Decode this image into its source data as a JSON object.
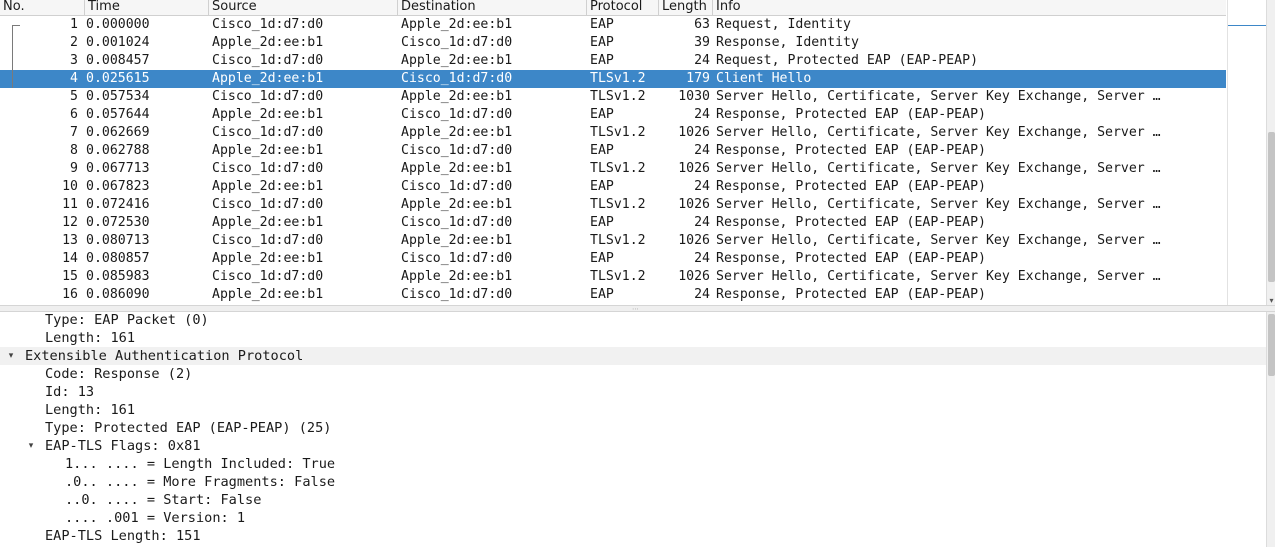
{
  "packet_list": {
    "columns": [
      "No.",
      "Time",
      "Source",
      "Destination",
      "Protocol",
      "Length",
      "Info"
    ],
    "selected_no": "4",
    "rows": [
      {
        "no": "1",
        "time": "0.000000",
        "src": "Cisco_1d:d7:d0",
        "dst": "Apple_2d:ee:b1",
        "proto": "EAP",
        "len": "63",
        "info": "Request, Identity"
      },
      {
        "no": "2",
        "time": "0.001024",
        "src": "Apple_2d:ee:b1",
        "dst": "Cisco_1d:d7:d0",
        "proto": "EAP",
        "len": "39",
        "info": "Response, Identity"
      },
      {
        "no": "3",
        "time": "0.008457",
        "src": "Cisco_1d:d7:d0",
        "dst": "Apple_2d:ee:b1",
        "proto": "EAP",
        "len": "24",
        "info": "Request, Protected EAP (EAP-PEAP)"
      },
      {
        "no": "4",
        "time": "0.025615",
        "src": "Apple_2d:ee:b1",
        "dst": "Cisco_1d:d7:d0",
        "proto": "TLSv1.2",
        "len": "179",
        "info": "Client Hello"
      },
      {
        "no": "5",
        "time": "0.057534",
        "src": "Cisco_1d:d7:d0",
        "dst": "Apple_2d:ee:b1",
        "proto": "TLSv1.2",
        "len": "1030",
        "info": "Server Hello, Certificate, Server Key Exchange, Server …"
      },
      {
        "no": "6",
        "time": "0.057644",
        "src": "Apple_2d:ee:b1",
        "dst": "Cisco_1d:d7:d0",
        "proto": "EAP",
        "len": "24",
        "info": "Response, Protected EAP (EAP-PEAP)"
      },
      {
        "no": "7",
        "time": "0.062669",
        "src": "Cisco_1d:d7:d0",
        "dst": "Apple_2d:ee:b1",
        "proto": "TLSv1.2",
        "len": "1026",
        "info": "Server Hello, Certificate, Server Key Exchange, Server …"
      },
      {
        "no": "8",
        "time": "0.062788",
        "src": "Apple_2d:ee:b1",
        "dst": "Cisco_1d:d7:d0",
        "proto": "EAP",
        "len": "24",
        "info": "Response, Protected EAP (EAP-PEAP)"
      },
      {
        "no": "9",
        "time": "0.067713",
        "src": "Cisco_1d:d7:d0",
        "dst": "Apple_2d:ee:b1",
        "proto": "TLSv1.2",
        "len": "1026",
        "info": "Server Hello, Certificate, Server Key Exchange, Server …"
      },
      {
        "no": "10",
        "time": "0.067823",
        "src": "Apple_2d:ee:b1",
        "dst": "Cisco_1d:d7:d0",
        "proto": "EAP",
        "len": "24",
        "info": "Response, Protected EAP (EAP-PEAP)"
      },
      {
        "no": "11",
        "time": "0.072416",
        "src": "Cisco_1d:d7:d0",
        "dst": "Apple_2d:ee:b1",
        "proto": "TLSv1.2",
        "len": "1026",
        "info": "Server Hello, Certificate, Server Key Exchange, Server …"
      },
      {
        "no": "12",
        "time": "0.072530",
        "src": "Apple_2d:ee:b1",
        "dst": "Cisco_1d:d7:d0",
        "proto": "EAP",
        "len": "24",
        "info": "Response, Protected EAP (EAP-PEAP)"
      },
      {
        "no": "13",
        "time": "0.080713",
        "src": "Cisco_1d:d7:d0",
        "dst": "Apple_2d:ee:b1",
        "proto": "TLSv1.2",
        "len": "1026",
        "info": "Server Hello, Certificate, Server Key Exchange, Server …"
      },
      {
        "no": "14",
        "time": "0.080857",
        "src": "Apple_2d:ee:b1",
        "dst": "Cisco_1d:d7:d0",
        "proto": "EAP",
        "len": "24",
        "info": "Response, Protected EAP (EAP-PEAP)"
      },
      {
        "no": "15",
        "time": "0.085983",
        "src": "Cisco_1d:d7:d0",
        "dst": "Apple_2d:ee:b1",
        "proto": "TLSv1.2",
        "len": "1026",
        "info": "Server Hello, Certificate, Server Key Exchange, Server …"
      },
      {
        "no": "16",
        "time": "0.086090",
        "src": "Apple_2d:ee:b1",
        "dst": "Cisco_1d:d7:d0",
        "proto": "EAP",
        "len": "24",
        "info": "Response, Protected EAP (EAP-PEAP)"
      }
    ]
  },
  "details": {
    "lines": [
      {
        "text": "Type: EAP Packet (0)",
        "depth": 1,
        "arrow": ""
      },
      {
        "text": "Length: 161",
        "depth": 1,
        "arrow": ""
      },
      {
        "text": "Extensible Authentication Protocol",
        "depth": 0,
        "arrow": "expanded",
        "highlight": true
      },
      {
        "text": "Code: Response (2)",
        "depth": 1,
        "arrow": ""
      },
      {
        "text": "Id: 13",
        "depth": 1,
        "arrow": ""
      },
      {
        "text": "Length: 161",
        "depth": 1,
        "arrow": ""
      },
      {
        "text": "Type: Protected EAP (EAP-PEAP) (25)",
        "depth": 1,
        "arrow": ""
      },
      {
        "text": "EAP-TLS Flags: 0x81",
        "depth": 1,
        "arrow": "expanded"
      },
      {
        "text": "1... .... = Length Included: True",
        "depth": 2,
        "arrow": ""
      },
      {
        "text": ".0.. .... = More Fragments: False",
        "depth": 2,
        "arrow": ""
      },
      {
        "text": "..0. .... = Start: False",
        "depth": 2,
        "arrow": ""
      },
      {
        "text": ".... .001 = Version: 1",
        "depth": 2,
        "arrow": ""
      },
      {
        "text": "EAP-TLS Length: 151",
        "depth": 1,
        "arrow": ""
      }
    ]
  },
  "icons": {
    "expanded": "▾",
    "scroll_down": "▾"
  },
  "colors": {
    "selection": "#3d87c8",
    "selection_text": "#ffffff",
    "highlight_row": "#f1f1f1"
  }
}
